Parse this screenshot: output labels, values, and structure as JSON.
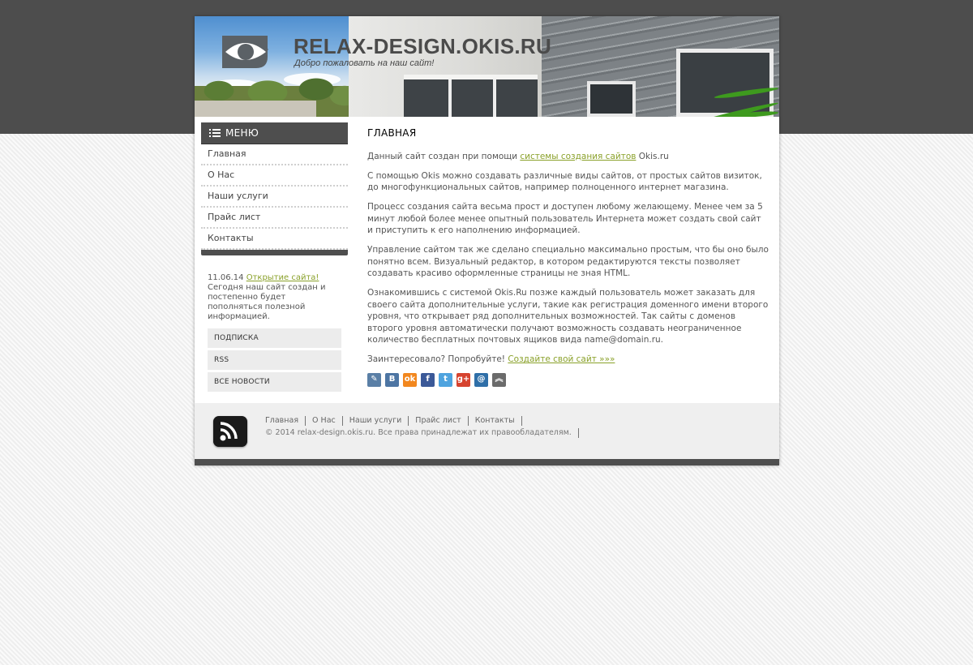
{
  "header": {
    "site_title": "RELAX-DESIGN.OKIS.RU",
    "slogan": "Добро пожаловать на наш сайт!"
  },
  "menu": {
    "title": "МЕНЮ",
    "items": [
      "Главная",
      "О Нас",
      "Наши услуги",
      "Прайс лист",
      "Контакты"
    ]
  },
  "news": {
    "date": "11.06.14",
    "link": "Открытие сайта!",
    "text": "Сегодня наш сайт создан и постепенно будет пополняться полезной информацией.",
    "buttons": [
      "ПОДПИСКА",
      "RSS",
      "ВСЕ НОВОСТИ"
    ]
  },
  "content": {
    "heading": "ГЛАВНАЯ",
    "p1_before": "Данный сайт создан при помощи ",
    "p1_link": "системы создания сайтов",
    "p1_after": " Okis.ru",
    "p2": "С помощью Okis можно создавать различные виды сайтов, от простых сайтов визиток, до многофункциональных сайтов, например полноценного интернет магазина.",
    "p3": "Процесс создания сайта весьма прост и доступен любому желающему. Менее чем за 5 минут любой более менее опытный пользователь Интернета может создать свой сайт и приступить к его наполнению информацией.",
    "p4": "Управление сайтом так же сделано специально максимально простым, что бы оно было понятно всем. Визуальный редактор, в котором редактируются тексты позволяет создавать красиво оформленные страницы не зная HTML.",
    "p5": "Ознакомившись с системой Okis.Ru позже каждый пользователь может заказать для своего сайта дополнительные услуги, такие как регистрация доменного имени второго уровня, что открывает ряд дополнительных возможностей. Так сайты с доменов второго уровня автоматически получают возможность создавать неограниченное количество бесплатных почтовых ящиков вида name@domain.ru.",
    "p6_before": "Заинтересовало? Попробуйте! ",
    "p6_link": "Создайте свой сайт »»»"
  },
  "share": [
    {
      "icon": "livejournal-icon",
      "glyph": "✎",
      "color": "#5a7fa6"
    },
    {
      "icon": "vkontakte-icon",
      "glyph": "В",
      "color": "#4d75a3"
    },
    {
      "icon": "odnoklassniki-icon",
      "glyph": "ok",
      "color": "#f2871e"
    },
    {
      "icon": "facebook-icon",
      "glyph": "f",
      "color": "#3b5998"
    },
    {
      "icon": "twitter-icon",
      "glyph": "t",
      "color": "#4fa4df"
    },
    {
      "icon": "google-plus-icon",
      "glyph": "g+",
      "color": "#d6432f"
    },
    {
      "icon": "mailru-icon",
      "glyph": "@",
      "color": "#2f6fa8"
    },
    {
      "icon": "more-icon",
      "glyph": "︽",
      "color": "#6b6b6b"
    }
  ],
  "footer": {
    "links": [
      "Главная",
      "О Нас",
      "Наши услуги",
      "Прайс лист",
      "Контакты"
    ],
    "copyright": "© 2014 relax-design.okis.ru. Все права принадлежат их правообладателям."
  }
}
